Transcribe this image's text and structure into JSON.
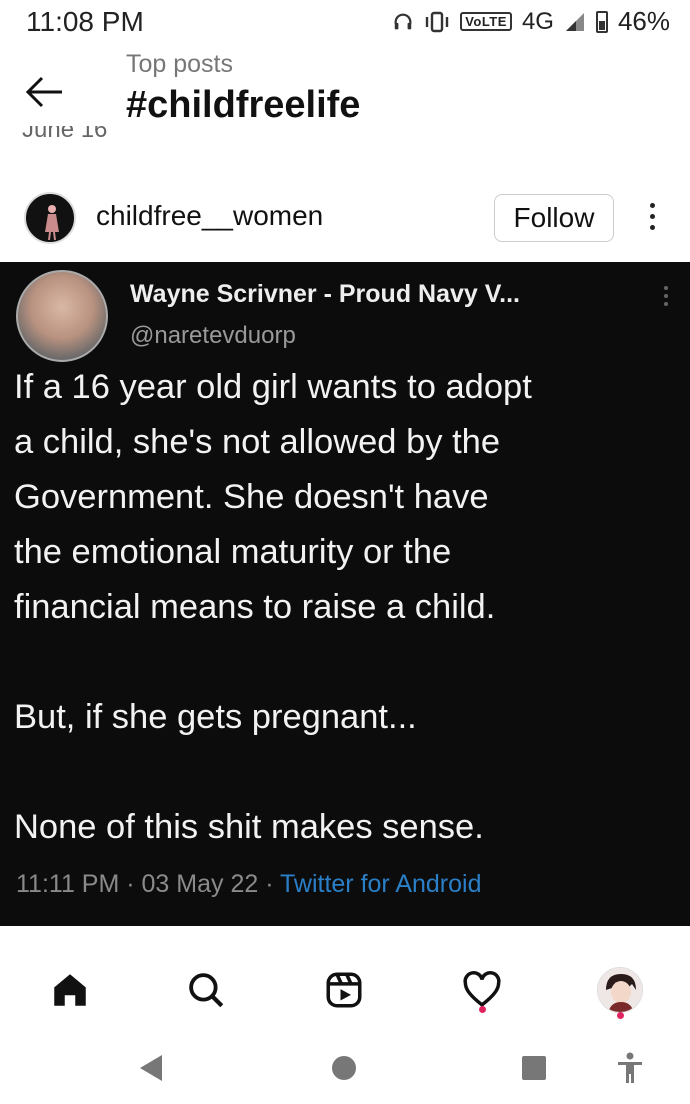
{
  "status_bar": {
    "time": "11:08 PM",
    "volte": "VoLTE",
    "network": "4G",
    "battery": "46%"
  },
  "header": {
    "subtitle": "Top posts",
    "title": "#childfreelife",
    "partial_date": "June 16"
  },
  "post": {
    "username": "childfree__women",
    "follow_label": "Follow",
    "tweet": {
      "author": "Wayne Scrivner - Proud Navy V...",
      "handle": "@naretevduorp",
      "lines": [
        "If a 16 year old girl wants to adopt",
        "a child, she's not allowed by the",
        "Government. She doesn't have",
        "the emotional maturity or the",
        "financial means to raise a child."
      ],
      "line2": "But, if she gets pregnant...",
      "line3": "None of this shit makes sense.",
      "timestamp": "11:11 PM · 03 May 22 · ",
      "source": "Twitter for Android"
    }
  },
  "bottom_nav": {
    "items": [
      "home-icon",
      "search-icon",
      "reels-icon",
      "activity-icon",
      "profile-avatar"
    ],
    "notification_color": "#e0245e"
  },
  "system_nav": [
    "back",
    "home",
    "recents",
    "accessibility"
  ]
}
